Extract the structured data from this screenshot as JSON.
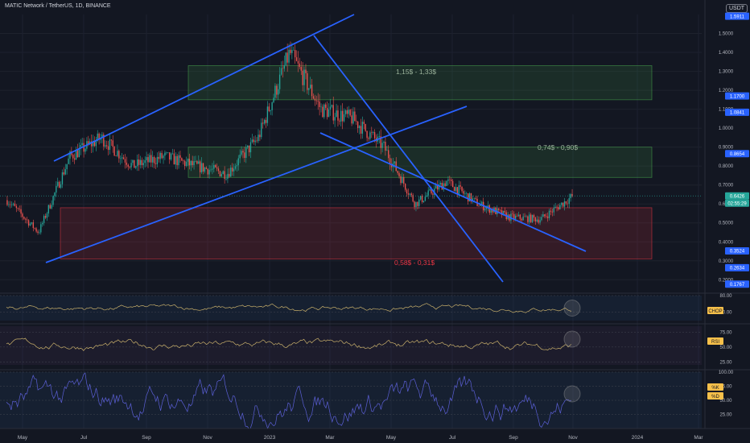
{
  "header": {
    "symbol": "MATIC Network / TetherUS, 1D, BINANCE",
    "currency": "USDT"
  },
  "chart_data": {
    "type": "candlestick",
    "price_axis": {
      "ticks": [
        "1.5000",
        "1.4000",
        "1.3000",
        "1.2000",
        "1.1000",
        "1.0000",
        "0.9000",
        "0.8000",
        "0.7000",
        "0.6000",
        "0.5000",
        "0.4000",
        "0.3000",
        "0.2000"
      ],
      "min": 0.2,
      "max": 1.5,
      "labels": [
        {
          "text": "1.5911",
          "value": 1.5911,
          "color": "#2962ff"
        },
        {
          "text": "1.1700",
          "value": 1.17,
          "color": "#2962ff"
        },
        {
          "text": "1.0841",
          "value": 1.0841,
          "color": "#2962ff"
        },
        {
          "text": "0.8654",
          "value": 0.8654,
          "color": "#2962ff"
        },
        {
          "text": "0.6426",
          "value": 0.6426,
          "color": "#26a69a"
        },
        {
          "text": "02:55:29",
          "value": 0.6,
          "color": "#26a69a"
        },
        {
          "text": "0.3524",
          "value": 0.3524,
          "color": "#2962ff"
        },
        {
          "text": "0.2634",
          "value": 0.2634,
          "color": "#2962ff"
        },
        {
          "text": "0.1767",
          "value": 0.1767,
          "color": "#2962ff"
        }
      ]
    },
    "time_axis": [
      "May",
      "Jul",
      "Sep",
      "Nov",
      "2023",
      "Mar",
      "May",
      "Jul",
      "Sep",
      "Nov",
      "2024",
      "Mar"
    ],
    "series": [
      {
        "name": "close",
        "x": [
          "May 2022",
          "Jun 2022",
          "Jul 2022",
          "Aug 2022",
          "Sep 2022",
          "Oct 2022",
          "Nov 2022",
          "Dec 2022",
          "Jan 2023",
          "Feb 2023",
          "Mar 2023",
          "Apr 2023",
          "May 2023",
          "Jun 2023",
          "Jul 2023",
          "Aug 2023",
          "Sep 2023",
          "Oct 2023",
          "Nov 2023"
        ],
        "values": [
          0.62,
          0.45,
          0.85,
          0.95,
          0.8,
          0.85,
          0.8,
          0.76,
          0.95,
          1.4,
          1.1,
          1.05,
          0.9,
          0.6,
          0.72,
          0.6,
          0.53,
          0.52,
          0.64
        ]
      }
    ],
    "zones": [
      {
        "label": "1,15$ - 1,33$",
        "low": 1.15,
        "high": 1.33,
        "color": "#4caf50"
      },
      {
        "label": "0,74$ - 0,90$",
        "low": 0.74,
        "high": 0.9,
        "color": "#4caf50"
      },
      {
        "label": "0,58$ - 0,31$",
        "low": 0.31,
        "high": 0.58,
        "color": "#f23645"
      }
    ],
    "indicators": [
      {
        "name": "CHOP",
        "ticks": [
          "80.00",
          "40.00"
        ],
        "min": 20,
        "max": 80,
        "color": "#c9b06b"
      },
      {
        "name": "RSI",
        "ticks": [
          "75.00",
          "50.00",
          "25.00"
        ],
        "min": 20,
        "max": 85,
        "color": "#c9b06b"
      },
      {
        "name": "%K",
        "name2": "%D",
        "ticks": [
          "100.00",
          "75.00",
          "50.00",
          "25.00"
        ],
        "min": 0,
        "max": 100,
        "color": "#5b5fd6"
      }
    ]
  }
}
